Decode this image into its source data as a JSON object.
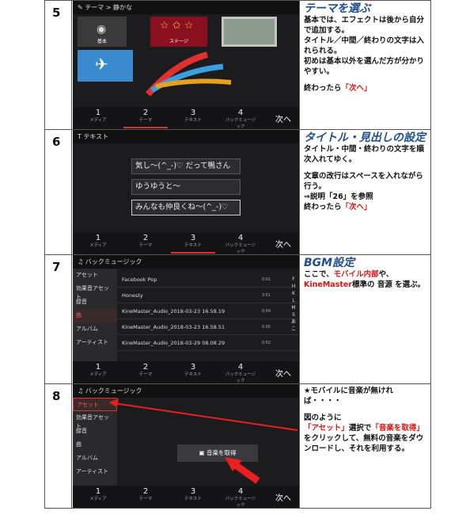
{
  "rows": [
    {
      "num": "5",
      "screen": {
        "topbar": "テーマ > 静かな",
        "thumb_labels": [
          "基本",
          "ステージ"
        ],
        "steps": [
          {
            "n": "1",
            "l": "メディア"
          },
          {
            "n": "2",
            "l": "テーマ"
          },
          {
            "n": "3",
            "l": "テキスト"
          },
          {
            "n": "4",
            "l": "バックミュージック"
          }
        ],
        "next": "次へ"
      },
      "text": {
        "title": "テーマを選ぶ",
        "lines": [
          "基本では、エフェクトは後から自分で追加する。",
          "タイトル／中間／終わりの文字は入れられる。",
          "初めは基本以外を選んだ方が分かりやすい。"
        ],
        "end_pre": "終わったら",
        "end_red": "「次へ」"
      }
    },
    {
      "num": "6",
      "screen": {
        "topbar": "T テキスト",
        "inputs": [
          "気し〜(^_-)♡ だって鴨さん",
          "ゆうゆうと〜",
          "みんなも仲良くね〜(^_-)♡"
        ],
        "steps": [
          {
            "n": "1",
            "l": "メディア"
          },
          {
            "n": "2",
            "l": "テーマ"
          },
          {
            "n": "3",
            "l": "テキスト"
          },
          {
            "n": "4",
            "l": "バックミュージック"
          }
        ],
        "next": "次へ"
      },
      "text": {
        "title": "タイトル・見出しの設定",
        "line1": "タイトル・中間・終わりの文字を順次入れてゆく。",
        "line2": "文章の改行はスペースを入れながら行う。",
        "line3": "⇒説明「26」を参照",
        "end_pre": "終わったら",
        "end_red": "「次へ」"
      }
    },
    {
      "num": "7",
      "screen": {
        "topbar": "バックミュージック",
        "side": [
          "アセット",
          "効果音アセット",
          "録音",
          "曲",
          "アルバム",
          "アーティスト"
        ],
        "songs": [
          {
            "title": "Facebook Pop",
            "dur": "0:01"
          },
          {
            "title": "Honesty",
            "dur": "3:51"
          },
          {
            "title": "KineMaster_Audio_2018-03-23 16.58.19",
            "dur": "0:04"
          },
          {
            "title": "KineMaster_Audio_2018-03-23 16.58.51",
            "dur": "0:05"
          },
          {
            "title": "KineMaster_Audio_2018-03-29 08.08.29",
            "dur": "0:02"
          }
        ],
        "alpha": [
          "F",
          "H",
          "K",
          "L",
          "M",
          "S",
          "あ",
          "こ"
        ],
        "steps": [
          {
            "n": "1",
            "l": "メディア"
          },
          {
            "n": "2",
            "l": "テーマ"
          },
          {
            "n": "3",
            "l": "テキスト"
          },
          {
            "n": "4",
            "l": "バックミュージック"
          }
        ],
        "next": "次へ"
      },
      "text": {
        "title": "BGM設定",
        "pre": "ここで、",
        "red1": "モバイル内部",
        "mid": "や、",
        "red2": "KineMaster",
        "post": "標準の 音源 を選ぶ。"
      }
    },
    {
      "num": "8",
      "screen": {
        "topbar": "バックミュージック",
        "side": [
          "アセット",
          "効果音アセット",
          "録音",
          "曲",
          "アルバム",
          "アーティスト"
        ],
        "get_music": "音楽を取得",
        "steps": [
          {
            "n": "1",
            "l": "メディア"
          },
          {
            "n": "2",
            "l": "テーマ"
          },
          {
            "n": "3",
            "l": "テキスト"
          },
          {
            "n": "4",
            "l": "バックミュージック"
          }
        ],
        "next": "次へ"
      },
      "text": {
        "line1": "★モバイルに音楽が無ければ・・・・",
        "line2": "図のように",
        "red1": "「アセット」",
        "mid1": "選択で",
        "red2": "「音楽を取得」",
        "rest": "をクリックして、無料の音楽をダウンロードし、それを利用する。"
      }
    }
  ],
  "colors": {
    "heading_blue": "#1f4f8f",
    "accent_red": "#e01010"
  }
}
